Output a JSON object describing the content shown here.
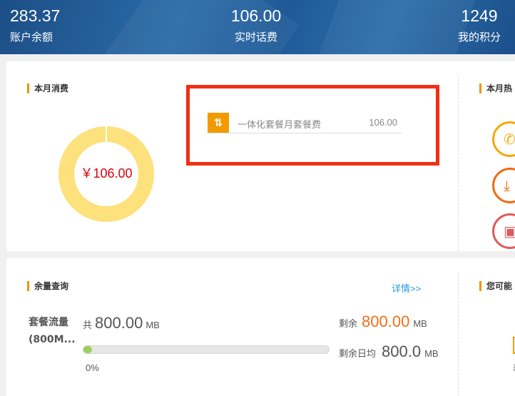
{
  "header": {
    "balance": {
      "value": "283.37",
      "label": "账户余额"
    },
    "realtime_fee": {
      "value": "106.00",
      "label": "实时话费"
    },
    "points": {
      "value": "1249",
      "label": "我的积分"
    }
  },
  "monthly": {
    "title": "本月消费",
    "total_display": "￥106.00",
    "items": [
      {
        "name": "一体化套餐月套餐费",
        "amount": "106.00"
      }
    ],
    "donut_color": "#fde17c"
  },
  "hot": {
    "title_partial": "本月热",
    "circles": [
      {
        "icon": "phone-icon",
        "glyph": "✆"
      },
      {
        "icon": "download-icon",
        "glyph": "⤓"
      },
      {
        "icon": "profile-card-icon",
        "glyph": "▣"
      }
    ]
  },
  "balance_query": {
    "title": "余量查询",
    "detail_link": "详情>>",
    "data_plan": {
      "name_line1": "套餐流量",
      "name_line2": "(800M...",
      "total_prefix": "共",
      "total_value": "800.00",
      "total_unit": "MB",
      "progress_percent": 0,
      "progress_label": "0%",
      "remaining_label": "剩余",
      "remaining_value": "800.00",
      "remaining_unit": "MB",
      "daily_label": "剩余日均",
      "daily_value": "800.0",
      "daily_unit": "MB"
    }
  },
  "maybe": {
    "title_partial": "您可能",
    "partial_text": "表"
  },
  "colors": {
    "accent": "#f39400",
    "highlight": "#f22e14",
    "amount_red": "#d9000d",
    "remaining_orange": "#f06e16",
    "link_blue": "#2a9ad8"
  }
}
